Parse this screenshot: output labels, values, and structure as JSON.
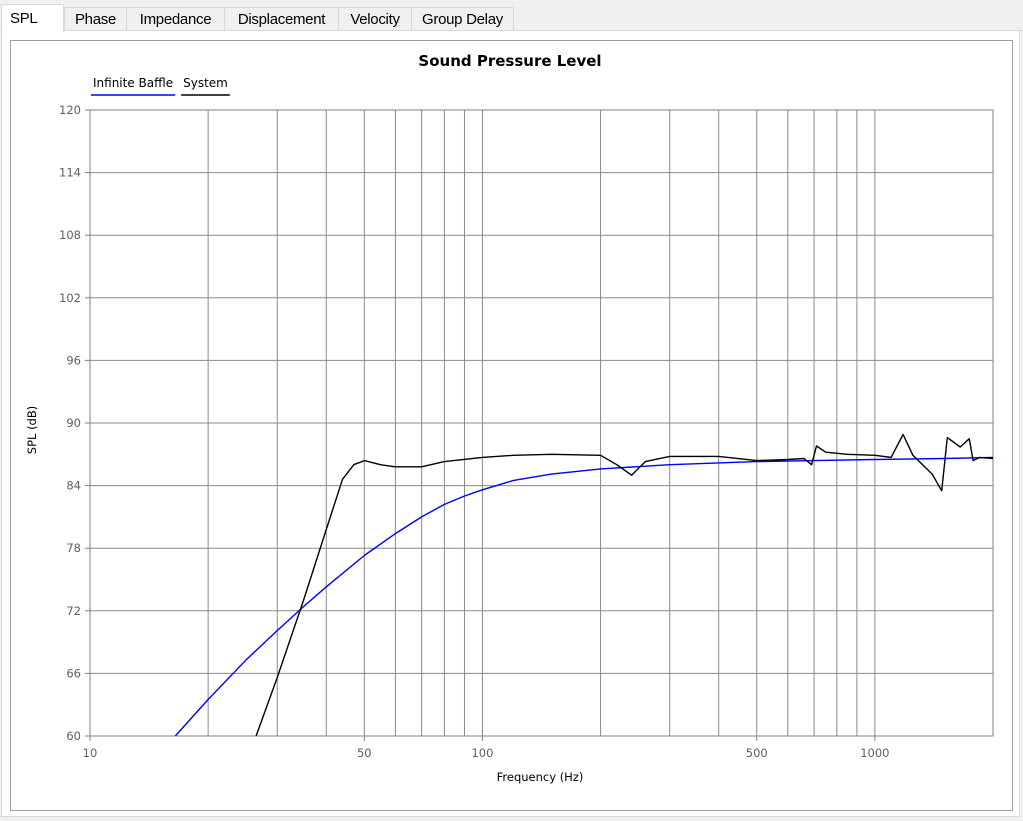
{
  "tabs": [
    {
      "label": "SPL",
      "active": true
    },
    {
      "label": "Phase",
      "active": false
    },
    {
      "label": "Impedance",
      "active": false
    },
    {
      "label": "Displacement",
      "active": false
    },
    {
      "label": "Velocity",
      "active": false
    },
    {
      "label": "Group Delay",
      "active": false
    }
  ],
  "chart_data": {
    "type": "line",
    "title": "Sound Pressure Level",
    "xlabel": "Frequency (Hz)",
    "ylabel": "SPL (dB)",
    "xscale": "log",
    "xlim": [
      10,
      2000
    ],
    "ylim": [
      60,
      120
    ],
    "grid": true,
    "legend_position": "top-left",
    "x_ticks": [
      10,
      50,
      100,
      500,
      1000
    ],
    "x_tick_labels": [
      "10",
      "50",
      "100",
      "500",
      "1000"
    ],
    "y_ticks": [
      60,
      66,
      72,
      78,
      84,
      90,
      96,
      102,
      108,
      114,
      120
    ],
    "y_tick_labels": [
      "60",
      "66",
      "72",
      "78",
      "84",
      "90",
      "96",
      "102",
      "108",
      "114",
      "120"
    ],
    "series": [
      {
        "name": "Infinite Baffle",
        "color": "#0000ff",
        "x": [
          16.5,
          20,
          25,
          30,
          35,
          40,
          50,
          60,
          70,
          80,
          90,
          100,
          120,
          150,
          200,
          300,
          500,
          700,
          1000,
          1500,
          2000
        ],
        "y": [
          60,
          63.5,
          67.3,
          70.1,
          72.4,
          74.3,
          77.3,
          79.4,
          81.0,
          82.2,
          83.0,
          83.6,
          84.5,
          85.1,
          85.6,
          86.0,
          86.3,
          86.4,
          86.5,
          86.6,
          86.7
        ]
      },
      {
        "name": "System",
        "color": "#000000",
        "x": [
          26.5,
          30,
          35,
          40,
          44,
          47,
          50,
          55,
          60,
          70,
          80,
          100,
          120,
          150,
          200,
          220,
          240,
          260,
          300,
          400,
          500,
          600,
          660,
          690,
          710,
          750,
          850,
          1000,
          1100,
          1180,
          1250,
          1400,
          1480,
          1530,
          1650,
          1740,
          1780,
          1850,
          2000
        ],
        "y": [
          60,
          65.6,
          73.0,
          79.8,
          84.6,
          86.0,
          86.4,
          86.0,
          85.8,
          85.8,
          86.3,
          86.7,
          86.9,
          87.0,
          86.9,
          86.0,
          85.0,
          86.3,
          86.8,
          86.8,
          86.4,
          86.5,
          86.6,
          86.0,
          87.8,
          87.2,
          87.0,
          86.9,
          86.7,
          88.9,
          86.9,
          85.1,
          83.5,
          88.6,
          87.7,
          88.5,
          86.4,
          86.7,
          86.6
        ]
      }
    ]
  }
}
